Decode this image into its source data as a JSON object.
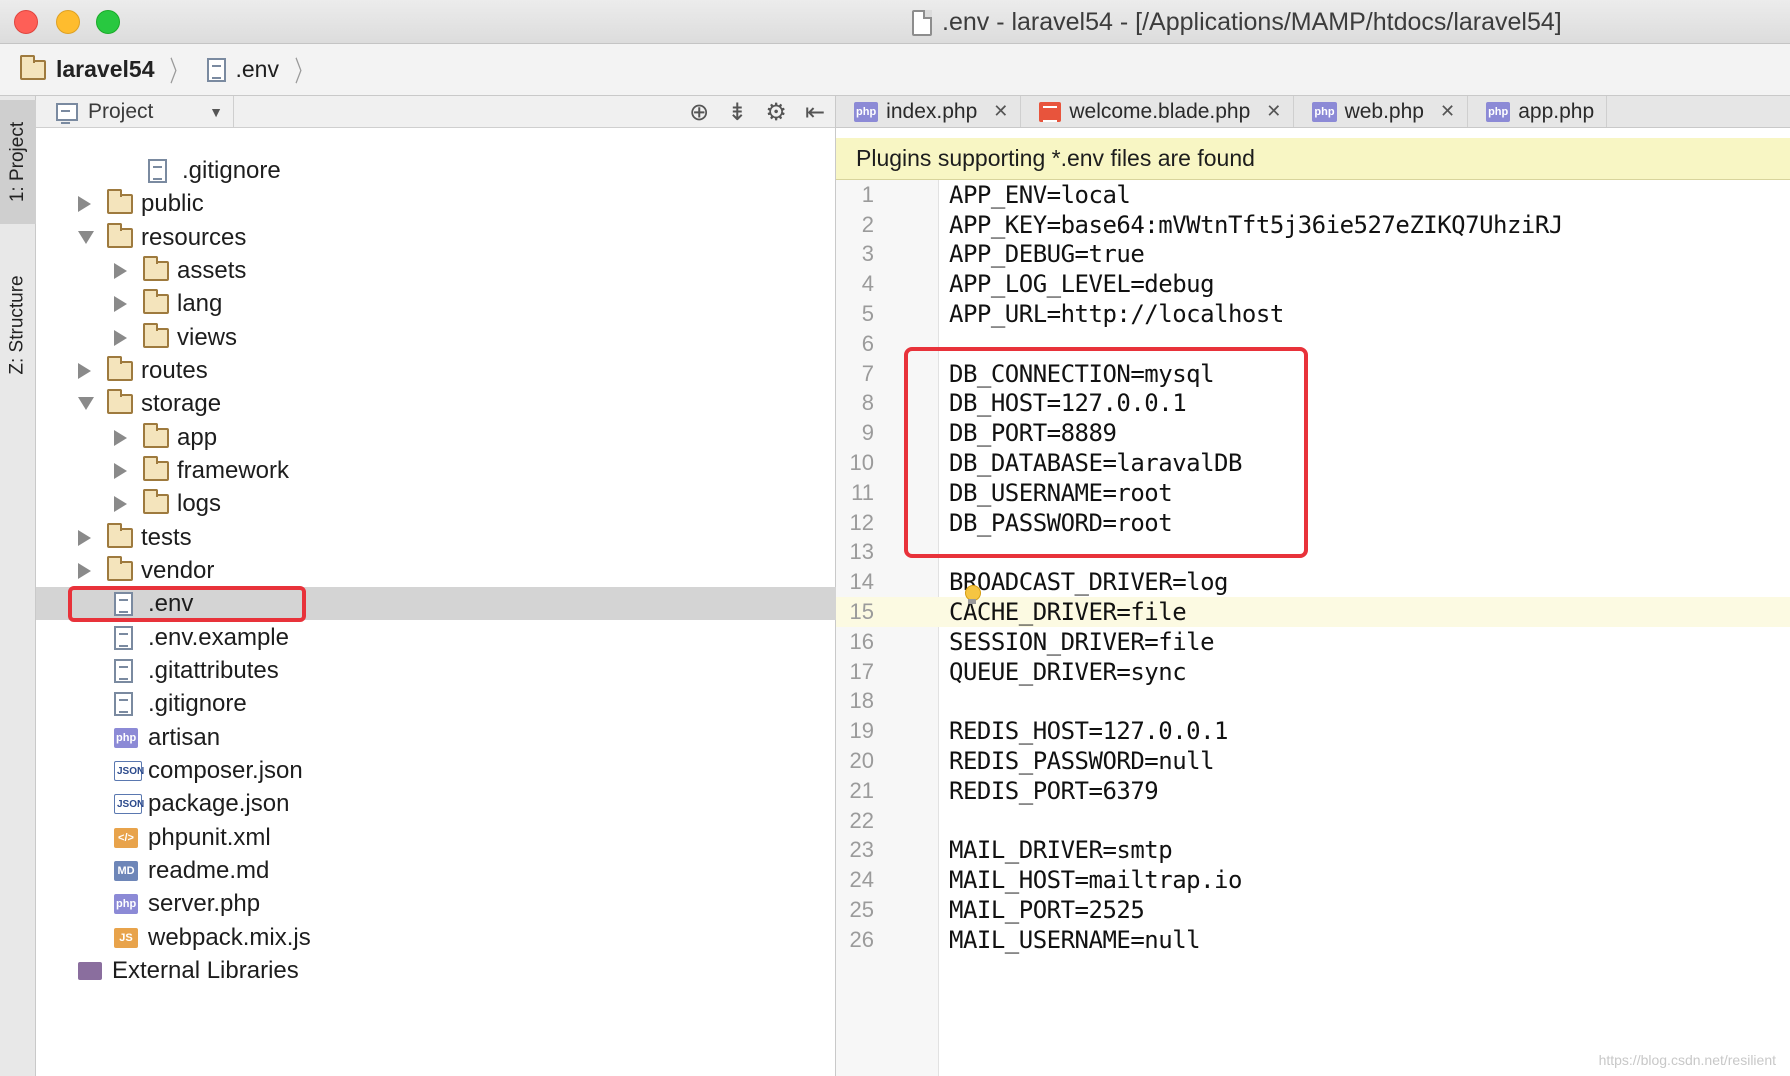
{
  "window": {
    "title": ".env - laravel54 - [/Applications/MAMP/htdocs/laravel54]"
  },
  "breadcrumb": {
    "project": "laravel54",
    "file": ".env"
  },
  "sidebar": {
    "project_tab": "1: Project",
    "structure_tab": "Z: Structure"
  },
  "project_panel": {
    "view_label": "Project",
    "items": [
      {
        "label": ".gitignore",
        "icon": "file-icon"
      },
      {
        "label": "public",
        "icon": "folder-icon"
      },
      {
        "label": "resources",
        "icon": "folder-icon"
      },
      {
        "label": "assets",
        "icon": "folder-icon"
      },
      {
        "label": "lang",
        "icon": "folder-icon"
      },
      {
        "label": "views",
        "icon": "folder-icon"
      },
      {
        "label": "routes",
        "icon": "folder-icon"
      },
      {
        "label": "storage",
        "icon": "folder-icon"
      },
      {
        "label": "app",
        "icon": "folder-icon"
      },
      {
        "label": "framework",
        "icon": "folder-icon"
      },
      {
        "label": "logs",
        "icon": "folder-icon"
      },
      {
        "label": "tests",
        "icon": "folder-icon"
      },
      {
        "label": "vendor",
        "icon": "folder-icon"
      },
      {
        "label": ".env",
        "icon": "file-icon"
      },
      {
        "label": ".env.example",
        "icon": "file-icon"
      },
      {
        "label": ".gitattributes",
        "icon": "file-icon"
      },
      {
        "label": ".gitignore",
        "icon": "file-icon"
      },
      {
        "label": "artisan",
        "icon": "php-icon"
      },
      {
        "label": "composer.json",
        "icon": "json-icon"
      },
      {
        "label": "package.json",
        "icon": "json-icon"
      },
      {
        "label": "phpunit.xml",
        "icon": "xml-icon"
      },
      {
        "label": "readme.md",
        "icon": "md-icon"
      },
      {
        "label": "server.php",
        "icon": "php-icon"
      },
      {
        "label": "webpack.mix.js",
        "icon": "js-icon"
      },
      {
        "label": "External Libraries",
        "icon": "library-icon"
      }
    ],
    "badges": {
      "php": "php",
      "json": "JSON",
      "md": "MD",
      "js": "JS"
    }
  },
  "editor": {
    "tabs": [
      {
        "label": "index.php",
        "icon": "php-icon"
      },
      {
        "label": "welcome.blade.php",
        "icon": "blade-icon"
      },
      {
        "label": "web.php",
        "icon": "php-icon"
      },
      {
        "label": "app.php",
        "icon": "php-icon"
      }
    ],
    "notice": "Plugins supporting *.env files are found",
    "current_line": 15,
    "lines": [
      "APP_ENV=local",
      "APP_KEY=base64:mVWtnTft5j36ie527eZIKQ7UhziRJ",
      "APP_DEBUG=true",
      "APP_LOG_LEVEL=debug",
      "APP_URL=http://localhost",
      "",
      "DB_CONNECTION=mysql",
      "DB_HOST=127.0.0.1",
      "DB_PORT=8889",
      "DB_DATABASE=laravalDB",
      "DB_USERNAME=root",
      "DB_PASSWORD=root",
      "",
      "BROADCAST_DRIVER=log",
      "CACHE_DRIVER=file",
      "SESSION_DRIVER=file",
      "QUEUE_DRIVER=sync",
      "",
      "REDIS_HOST=127.0.0.1",
      "REDIS_PASSWORD=null",
      "REDIS_PORT=6379",
      "",
      "MAIL_DRIVER=smtp",
      "MAIL_HOST=mailtrap.io",
      "MAIL_PORT=2525",
      "MAIL_USERNAME=null"
    ]
  },
  "watermark": "https://blog.csdn.net/resilient",
  "colors": {
    "highlight_border": "#e8323a",
    "notice_bg": "#f8f6c4",
    "selected_row": "#d4d4d4"
  }
}
